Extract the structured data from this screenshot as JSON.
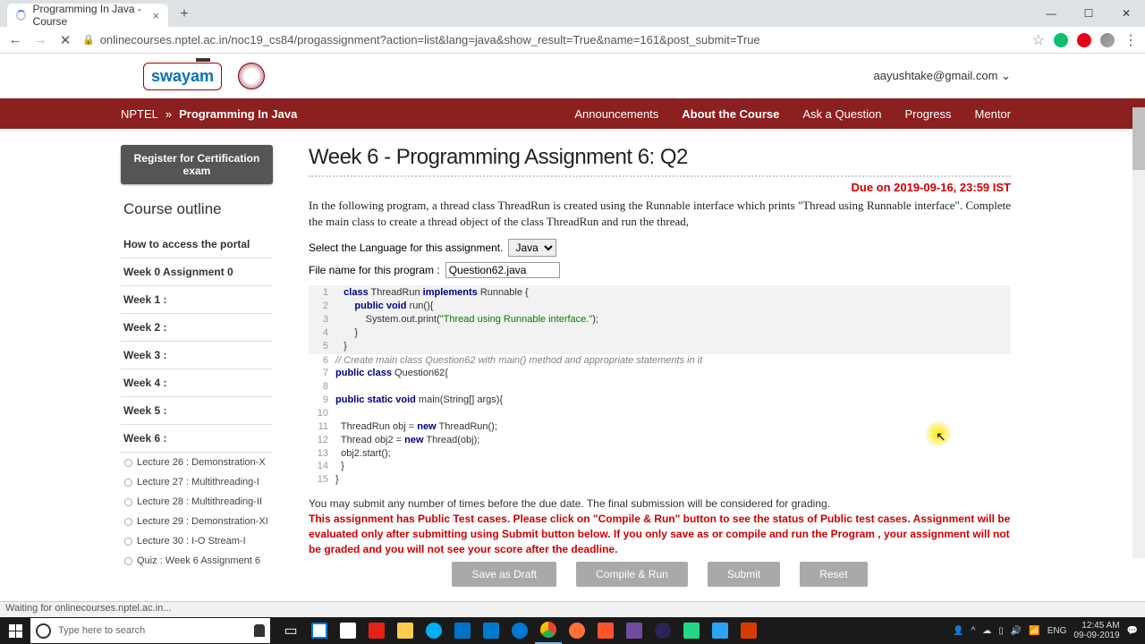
{
  "browser": {
    "tab_title": "Programming In Java - Course",
    "url": "onlinecourses.nptel.ac.in/noc19_cs84/progassignment?action=list&lang=java&show_result=True&name=161&post_submit=True",
    "status_text": "Waiting for onlinecourses.nptel.ac.in..."
  },
  "header": {
    "logo_text": "swayam",
    "user_email": "aayushtake@gmail.com"
  },
  "breadcrumb": {
    "root": "NPTEL",
    "sep": "»",
    "course": "Programming In Java"
  },
  "nav": [
    "Announcements",
    "About the Course",
    "Ask a Question",
    "Progress",
    "Mentor"
  ],
  "nav_active_index": 1,
  "sidebar": {
    "register_btn": "Register for Certification exam",
    "outline_title": "Course outline",
    "items": [
      "How to access the portal",
      "Week 0 Assignment 0",
      "Week 1 :",
      "Week 2 :",
      "Week 3 :",
      "Week 4 :",
      "Week 5 :",
      "Week 6 :"
    ],
    "lectures": [
      "Lecture 26 : Demonstration-X",
      "Lecture 27 : Multithreading-I",
      "Lecture 28 : Multithreading-II",
      "Lecture 29 : Demonstration-XI",
      "Lecture 30 : I-O Stream-I",
      "Quiz : Week 6 Assignment 6"
    ]
  },
  "main": {
    "title": "Week 6 - Programming Assignment 6: Q2",
    "due": "Due on 2019-09-16, 23:59 IST",
    "desc": "In the following program, a thread class ThreadRun is created using the Runnable interface which prints \"Thread using Runnable interface\". Complete the main class to create a thread object of the class ThreadRun and run the thread,",
    "lang_label": "Select the Language for this assignment.",
    "lang_value": "Java",
    "file_label": "File name for this program :",
    "file_value": "Question62.java",
    "submit_note": "You may submit any number of times before the due date. The final submission will be considered for grading.",
    "red_note": "This assignment has Public Test cases. Please click on \"Compile & Run\" button to see the status of Public test cases. Assignment will be evaluated only after submitting using Submit button below. If you only save as or compile and run the Program , your assignment will not be graded and you will not see your score after the deadline.",
    "buttons": [
      "Save as Draft",
      "Compile & Run",
      "Submit",
      "Reset"
    ]
  },
  "code": {
    "gray": [
      {
        "n": "1",
        "html": "   <span class=\"kw\">class</span> ThreadRun <span class=\"kw\">implements</span> Runnable {"
      },
      {
        "n": "2",
        "html": "       <span class=\"kw\">public void</span> run(){"
      },
      {
        "n": "3",
        "html": "           System.out.print(<span class=\"str\">\"Thread using Runnable interface.\"</span>);"
      },
      {
        "n": "4",
        "html": "       }"
      },
      {
        "n": "5",
        "html": "   }"
      }
    ],
    "white": [
      {
        "n": "6",
        "html": "<span class=\"cmt\">// Create main class Question62 with main() method and appropriate statements in it</span>"
      },
      {
        "n": "7",
        "html": "<span class=\"kw\">public class</span> Question62{"
      },
      {
        "n": "8",
        "html": ""
      },
      {
        "n": "9",
        "html": "<span class=\"kw\">public static void</span> main(String[] args){"
      },
      {
        "n": "10",
        "html": ""
      },
      {
        "n": "11",
        "html": "  ThreadRun obj = <span class=\"kw\">new</span> ThreadRun();"
      },
      {
        "n": "12",
        "html": "  Thread obj2 = <span class=\"kw\">new</span> Thread(obj);"
      },
      {
        "n": "13",
        "html": "  obj2.start();"
      },
      {
        "n": "14",
        "html": "  }"
      },
      {
        "n": "15",
        "html": "}"
      }
    ]
  },
  "taskbar": {
    "search_placeholder": "Type here to search",
    "lang": "ENG",
    "time": "12:45 AM",
    "date": "09-09-2019"
  }
}
